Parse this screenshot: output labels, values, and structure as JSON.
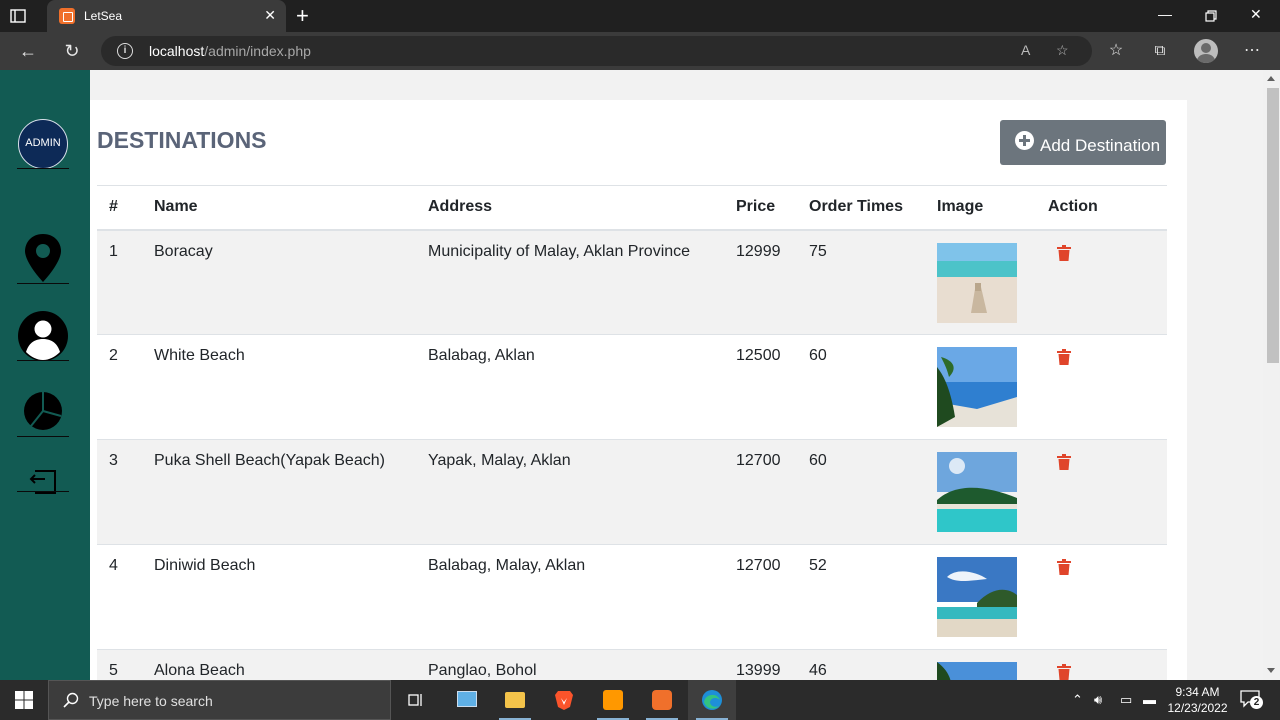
{
  "browser": {
    "tab_title": "LetSea",
    "url_host": "localhost",
    "url_path": "/admin/index.php"
  },
  "sidebar": {
    "admin_label": "ADMIN",
    "icons": [
      "location-pin-icon",
      "user-icon",
      "pie-chart-icon",
      "logout-icon"
    ]
  },
  "page": {
    "title": "DESTINATIONS",
    "add_button_label": "Add Destination"
  },
  "table": {
    "headers": [
      "#",
      "Name",
      "Address",
      "Price",
      "Order Times",
      "Image",
      "Action"
    ],
    "rows": [
      {
        "num": "1",
        "name": "Boracay",
        "address": "Municipality of Malay, Aklan Province",
        "price": "12999",
        "orders": "75"
      },
      {
        "num": "2",
        "name": "White Beach",
        "address": "Balabag, Aklan",
        "price": "12500",
        "orders": "60"
      },
      {
        "num": "3",
        "name": "Puka Shell Beach(Yapak Beach)",
        "address": "Yapak, Malay, Aklan",
        "price": "12700",
        "orders": "60"
      },
      {
        "num": "4",
        "name": "Diniwid Beach",
        "address": "Balabag, Malay, Aklan",
        "price": "12700",
        "orders": "52"
      },
      {
        "num": "5",
        "name": "Alona Beach",
        "address": "Panglao, Bohol",
        "price": "13999",
        "orders": "46"
      }
    ]
  },
  "taskbar": {
    "search_placeholder": "Type here to search",
    "time": "9:34 AM",
    "date": "12/23/2022",
    "notification_count": "2"
  },
  "colors": {
    "sidebar": "#125b53",
    "admin_badge": "#0d2a57",
    "title": "#5a6478",
    "button": "#6c757d",
    "trash": "#e0452b"
  }
}
